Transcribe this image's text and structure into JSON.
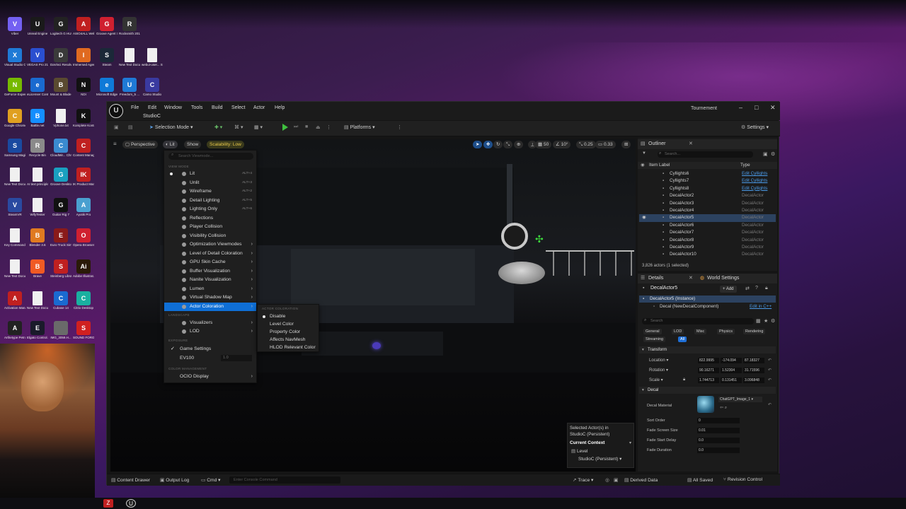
{
  "desktop": {
    "icons": [
      {
        "label": "Viber",
        "color": "#7360f2",
        "glyph": "V"
      },
      {
        "label": "Unreal Engine",
        "color": "#1a1a1a",
        "glyph": "U"
      },
      {
        "label": "Logitech G HUB",
        "color": "#222",
        "glyph": "G"
      },
      {
        "label": "ASIO4ALL Web Site",
        "color": "#c02020",
        "glyph": "A"
      },
      {
        "label": "Groove Agent SE 5",
        "color": "#d02030",
        "glyph": "G"
      },
      {
        "label": "Rocksmith 2014 Editio...",
        "color": "#333",
        "glyph": "R"
      },
      {
        "label": "Visual Studio Code",
        "color": "#1f7ad6",
        "glyph": "X"
      },
      {
        "label": "VEGAS Pro 21.0",
        "color": "#2a4fd0",
        "glyph": "V"
      },
      {
        "label": "DaVinci Resolve",
        "color": "#3a3a3a",
        "glyph": "D"
      },
      {
        "label": "Immersed Agent",
        "color": "#e06a20",
        "glyph": "I"
      },
      {
        "label": "Steam",
        "color": "#1b2838",
        "glyph": "S"
      },
      {
        "label": "New Text Docume...",
        "color": "#f0f0f0",
        "glyph": ""
      },
      {
        "label": "webui-user... Shortcut",
        "color": "#f0f0f0",
        "glyph": ""
      },
      {
        "label": "GeForce Experience",
        "color": "#76b900",
        "glyph": "N"
      },
      {
        "label": "eLicenser Control...",
        "color": "#1a6ad0",
        "glyph": "e"
      },
      {
        "label": "Mount & Blade II B...",
        "color": "#5a4a30",
        "glyph": "B"
      },
      {
        "label": "NDI",
        "color": "#111",
        "glyph": "N"
      },
      {
        "label": "Microsoft Edge",
        "color": "#0f7ad8",
        "glyph": "e"
      },
      {
        "label": "Freedom_5 ...",
        "color": "#1f7ad6",
        "glyph": "U"
      },
      {
        "label": "Camo Studio",
        "color": "#3a3aa0",
        "glyph": "C"
      },
      {
        "label": "Google Chrome",
        "color": "#e0a020",
        "glyph": "C"
      },
      {
        "label": "Battle.net",
        "color": "#148eff",
        "glyph": "B"
      },
      {
        "label": "Vphone.txt",
        "color": "#f0f0f0",
        "glyph": ""
      },
      {
        "label": "Komplete Kontrol",
        "color": "#111",
        "glyph": "K"
      },
      {
        "label": "Samsung Magician",
        "color": "#1a4aa0",
        "glyph": "S"
      },
      {
        "label": "Recycle Bin",
        "color": "#8a8a8a",
        "glyph": "R"
      },
      {
        "label": "CloudMir... Chrome",
        "color": "#3a8ad0",
        "glyph": "C"
      },
      {
        "label": "Content Manager.e...",
        "color": "#c02020",
        "glyph": "C"
      },
      {
        "label": "New Text Docume...",
        "color": "#f0f0f0",
        "glyph": ""
      },
      {
        "label": "AI text principles.txt",
        "color": "#f0f0f0",
        "glyph": ""
      },
      {
        "label": "Groove Desktop",
        "color": "#1aa0c0",
        "glyph": "G"
      },
      {
        "label": "IK Product Manager",
        "color": "#c02020",
        "glyph": "IK"
      },
      {
        "label": "SteamVR",
        "color": "#2a4aa0",
        "glyph": "V"
      },
      {
        "label": "WifyTester",
        "color": "#f0f0f0",
        "glyph": ""
      },
      {
        "label": "Guitar Rig 7",
        "color": "#111",
        "glyph": "G"
      },
      {
        "label": "Ayotik Pro",
        "color": "#4aa0d0",
        "glyph": "A"
      },
      {
        "label": "Key Commands.txt",
        "color": "#f0f0f0",
        "glyph": ""
      },
      {
        "label": "Blender 3.6",
        "color": "#e07a20",
        "glyph": "B"
      },
      {
        "label": "Euro Truck Simulator 2",
        "color": "#8a1a1a",
        "glyph": "E"
      },
      {
        "label": "Opera Browser",
        "color": "#d02030",
        "glyph": "O"
      },
      {
        "label": "New Text Docume...",
        "color": "#f0f0f0",
        "glyph": ""
      },
      {
        "label": "Brave",
        "color": "#f05a24",
        "glyph": "B"
      },
      {
        "label": "Steinberg Library M...",
        "color": "#c02020",
        "glyph": "S"
      },
      {
        "label": "Adobe Illustrat...",
        "color": "#2a1a08",
        "glyph": "Ai"
      },
      {
        "label": "Activation Manager",
        "color": "#c02020",
        "glyph": "A"
      },
      {
        "label": "New Text Docume...",
        "color": "#f0f0f0",
        "glyph": ""
      },
      {
        "label": "Cubase 14",
        "color": "#1a6ad0",
        "glyph": "C"
      },
      {
        "label": "Citrix Desktop",
        "color": "#1ab0a0",
        "glyph": "C"
      },
      {
        "label": "Arthetype Petrucci X",
        "color": "#222",
        "glyph": "A"
      },
      {
        "label": "Elgato Control...",
        "color": "#1a1a2a",
        "glyph": "E"
      },
      {
        "label": "IMG_3059.H...",
        "color": "#6a6a6a",
        "glyph": ""
      },
      {
        "label": "SOUND FORGE Audi...",
        "color": "#d02020",
        "glyph": "S"
      }
    ]
  },
  "editor": {
    "menu": [
      "File",
      "Edit",
      "Window",
      "Tools",
      "Build",
      "Select",
      "Actor",
      "Help"
    ],
    "project": "StudioC",
    "window_title": "Tournement",
    "toolbar": {
      "selection_mode": "Selection Mode",
      "platforms": "Platforms",
      "settings": "Settings"
    },
    "viewport": {
      "perspective": "Perspective",
      "lit": "Lit",
      "show": "Show",
      "scalability": "Scalability: Low",
      "snap_grid": "50",
      "snap_rot": "10°",
      "snap_scale": "0.25",
      "cam_speed": "0.33"
    },
    "view_menu": {
      "search_placeholder": "Search Viewmode...",
      "section_view_mode": "VIEW MODE",
      "items": [
        {
          "label": "Lit",
          "shortcut": "ALT+4",
          "radio": true
        },
        {
          "label": "Unlit",
          "shortcut": "ALT+3"
        },
        {
          "label": "Wireframe",
          "shortcut": "ALT+2"
        },
        {
          "label": "Detail Lighting",
          "shortcut": "ALT+5"
        },
        {
          "label": "Lighting Only",
          "shortcut": "ALT+6"
        },
        {
          "label": "Reflections",
          "shortcut": ""
        },
        {
          "label": "Player Collision",
          "shortcut": ""
        },
        {
          "label": "Visibility Collision",
          "shortcut": ""
        },
        {
          "label": "Optimization Viewmodes",
          "arrow": true
        },
        {
          "label": "Level of Detail Coloration",
          "arrow": true
        },
        {
          "label": "GPU Skin Cache",
          "arrow": true
        },
        {
          "label": "Buffer Visualization",
          "arrow": true
        },
        {
          "label": "Nanite Visualization",
          "arrow": true
        },
        {
          "label": "Lumen",
          "arrow": true
        },
        {
          "label": "Virtual Shadow Map",
          "arrow": true
        },
        {
          "label": "Actor Coloration",
          "arrow": true
        }
      ],
      "section_landscape": "LANDSCAPE",
      "landscape_items": [
        {
          "label": "Visualizers"
        },
        {
          "label": "LOD"
        }
      ],
      "section_exposure": "EXPOSURE",
      "game_settings": "Game Settings",
      "ev100_label": "EV100",
      "ev100_value": "1.0",
      "section_color": "COLOR MANAGEMENT",
      "ocio": "OCIO Display"
    },
    "actor_coloration_menu": {
      "header": "ACTOR COLORATION",
      "items": [
        "Disable",
        "Level Color",
        "Property Color",
        "Affects NavMesh",
        "HLOD Relevant Color"
      ]
    },
    "selection_panel": {
      "line1": "Selected Actor(s) in",
      "line2": "StudioC (Persistent)",
      "current_context": "Current Context",
      "level_label": "Level",
      "level_value": "StudioC (Persistent)"
    },
    "outliner": {
      "title": "Outliner",
      "search_placeholder": "Search...",
      "col_label": "Item Label",
      "col_type": "Type",
      "rows": [
        {
          "name": "Cyllights6",
          "type": "Edit Cyllights",
          "edit": true
        },
        {
          "name": "Cyllights7",
          "type": "Edit Cyllights",
          "edit": true
        },
        {
          "name": "Cyllights8",
          "type": "Edit Cyllights",
          "edit": true
        },
        {
          "name": "DecalActor2",
          "type": "DecalActor"
        },
        {
          "name": "DecalActor3",
          "type": "DecalActor"
        },
        {
          "name": "DecalActor4",
          "type": "DecalActor"
        },
        {
          "name": "DecalActor5",
          "type": "DecalActor",
          "selected": true
        },
        {
          "name": "DecalActor6",
          "type": "DecalActor"
        },
        {
          "name": "DecalActor7",
          "type": "DecalActor"
        },
        {
          "name": "DecalActor8",
          "type": "DecalActor"
        },
        {
          "name": "DecalActor9",
          "type": "DecalActor"
        },
        {
          "name": "DecalActor10",
          "type": "DecalActor"
        }
      ],
      "count": "3,826 actors (1 selected)"
    },
    "details": {
      "tab_details": "Details",
      "tab_world": "World Settings",
      "actor_name": "DecalActor5",
      "add": "+ Add",
      "instance": "DecalActor5 (Instance)",
      "component": "Decal (NewDecalComponent)",
      "edit_cpp": "Edit in C++",
      "search_placeholder": "Search",
      "filters": [
        "General",
        "LOD",
        "Misc",
        "Physics",
        "Rendering",
        "Streaming",
        "All"
      ],
      "transform_header": "Transform",
      "location_label": "Location",
      "location": [
        "822.9995",
        "-174.094",
        "87.18327"
      ],
      "rotation_label": "Rotation",
      "rotation": [
        "90.16271",
        "1.52304",
        "31.71596"
      ],
      "scale_label": "Scale",
      "scale": [
        "1.744713",
        "0.131451",
        "3.096848"
      ],
      "decal_header": "Decal",
      "decal_material_label": "Decal Material",
      "decal_material_value": "ChatGPT_Image_1",
      "sort_order_label": "Sort Order",
      "sort_order": "0",
      "fade_screen_label": "Fade Screen Size",
      "fade_screen": "0.01",
      "fade_start_label": "Fade Start Delay",
      "fade_start": "0.0",
      "fade_duration_label": "Fade Duration",
      "fade_duration": "0.0"
    },
    "bottom": {
      "content_drawer": "Content Drawer",
      "output_log": "Output Log",
      "cmd": "Cmd",
      "console_placeholder": "Enter Console Command",
      "trace": "Trace",
      "derived_data": "Derived Data",
      "all_saved": "All Saved",
      "revision_control": "Revision Control"
    }
  }
}
